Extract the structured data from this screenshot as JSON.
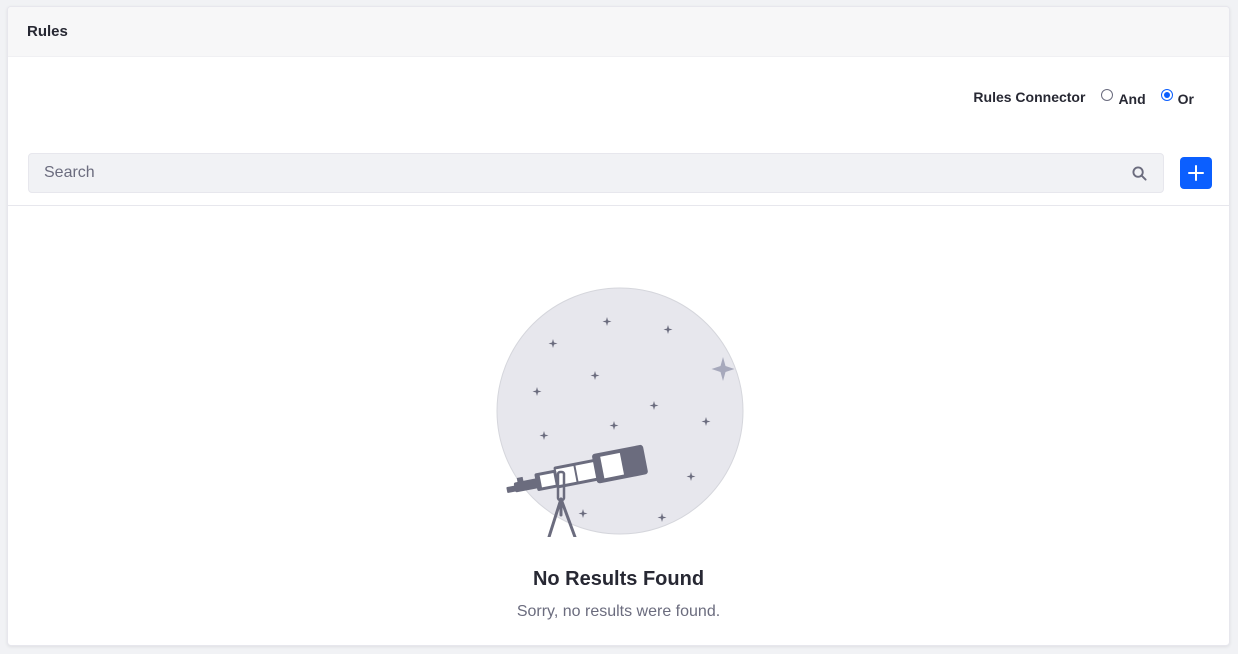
{
  "panel": {
    "title": "Rules"
  },
  "connector": {
    "label": "Rules Connector",
    "options": [
      {
        "label": "And",
        "selected": false
      },
      {
        "label": "Or",
        "selected": true
      }
    ]
  },
  "search": {
    "placeholder": "Search",
    "value": "",
    "icon": "search-icon"
  },
  "add_button": {
    "icon": "plus-icon",
    "color": "#0b5fff"
  },
  "empty_state": {
    "title": "No Results Found",
    "subtitle": "Sorry, no results were found.",
    "illustration": "telescope-stars-illustration"
  }
}
